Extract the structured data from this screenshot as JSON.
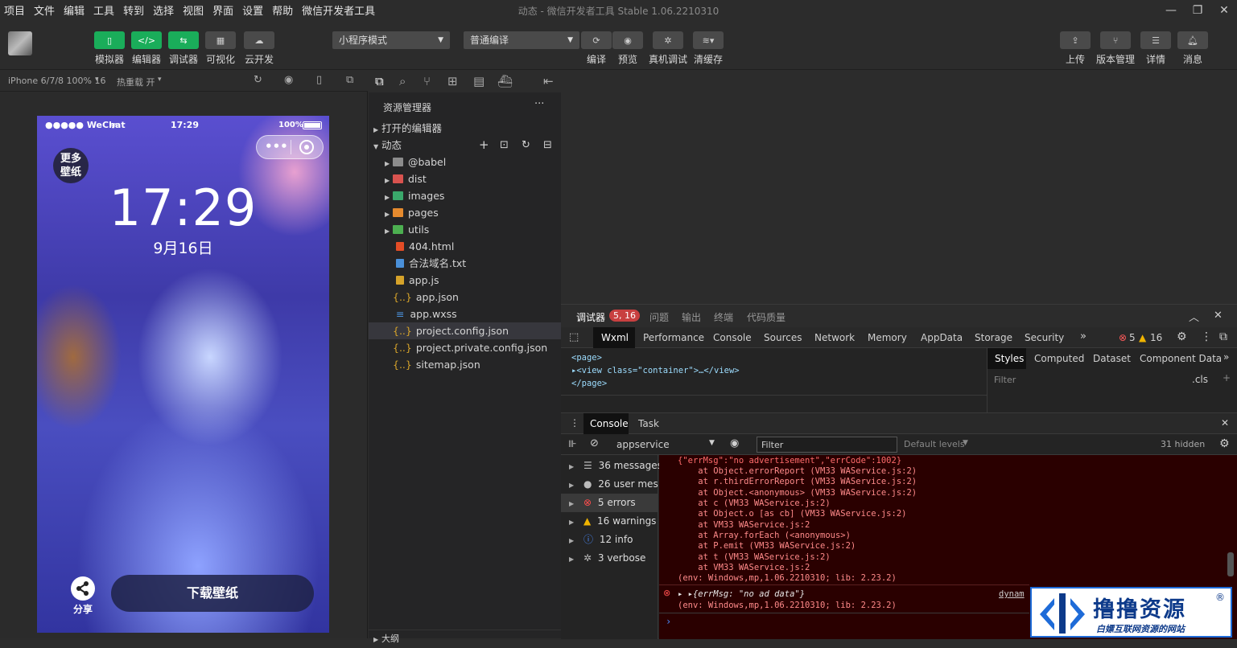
{
  "menubar": {
    "items": [
      "项目",
      "文件",
      "编辑",
      "工具",
      "转到",
      "选择",
      "视图",
      "界面",
      "设置",
      "帮助",
      "微信开发者工具"
    ],
    "title": "动态 - 微信开发者工具 Stable 1.06.2210310"
  },
  "toolbar": {
    "simulator": "模拟器",
    "editor": "编辑器",
    "debugger": "调试器",
    "visual": "可视化",
    "cloud": "云开发",
    "mode_select": "小程序模式",
    "compile_select": "普通编译",
    "compile": "编译",
    "preview": "预览",
    "real_debug": "真机调试",
    "clear_cache": "清缓存",
    "upload": "上传",
    "version": "版本管理",
    "details": "详情",
    "messages": "消息"
  },
  "simulator": {
    "device": "iPhone 6/7/8 100% 16",
    "hot_reload": "热重载 开",
    "carrier": "●●●●● WeChat",
    "time": "17:29",
    "battery": "100%",
    "big_time": "17:29",
    "date": "9月16日",
    "more_wallpaper": "更多壁纸",
    "share": "分享",
    "download": "下载壁纸"
  },
  "explorer": {
    "title": "资源管理器",
    "open_editors": "打开的编辑器",
    "project": "动态",
    "items": [
      {
        "name": "@babel",
        "type": "folder"
      },
      {
        "name": "dist",
        "type": "folder"
      },
      {
        "name": "images",
        "type": "folder"
      },
      {
        "name": "pages",
        "type": "folder"
      },
      {
        "name": "utils",
        "type": "folder"
      },
      {
        "name": "404.html",
        "type": "html"
      },
      {
        "name": "合法域名.txt",
        "type": "txt"
      },
      {
        "name": "app.js",
        "type": "js"
      },
      {
        "name": "app.json",
        "type": "json"
      },
      {
        "name": "app.wxss",
        "type": "wxss"
      },
      {
        "name": "project.config.json",
        "type": "json"
      },
      {
        "name": "project.private.config.json",
        "type": "json"
      },
      {
        "name": "sitemap.json",
        "type": "json"
      }
    ],
    "outline": "大纲"
  },
  "devtools": {
    "top_tabs": [
      "调试器",
      "问题",
      "输出",
      "终端",
      "代码质量"
    ],
    "badge": "5, 16",
    "panel_tabs": [
      "Wxml",
      "Performance",
      "Console",
      "Sources",
      "Network",
      "Memory",
      "AppData",
      "Storage",
      "Security"
    ],
    "error_count": "5",
    "warning_count": "16",
    "wxml_lines": [
      "<page>",
      "▸<view class=\"container\">…</view>",
      "</page>"
    ],
    "style_tabs": [
      "Styles",
      "Computed",
      "Dataset",
      "Component Data"
    ],
    "filter_placeholder": "Filter",
    "cls": ".cls",
    "console_tabs": [
      "Console",
      "Task"
    ],
    "context": "appservice",
    "console_filter": "Filter",
    "default_levels": "Default levels",
    "hidden": "31 hidden",
    "sidebar": [
      {
        "label": "36 messages",
        "icon": "list-icon"
      },
      {
        "label": "26 user mes...",
        "icon": "user-icon"
      },
      {
        "label": "5 errors",
        "icon": "error-icon"
      },
      {
        "label": "16 warnings",
        "icon": "warning-icon"
      },
      {
        "label": "12 info",
        "icon": "info-icon"
      },
      {
        "label": "3 verbose",
        "icon": "bug-icon"
      }
    ],
    "error_lines": [
      "{\"errMsg\":\"no advertisement\",\"errCode\":1002}",
      "    at Object.errorReport (VM33 WAService.js:2)",
      "    at r.thirdErrorReport (VM33 WAService.js:2)",
      "    at Object.<anonymous> (VM33 WAService.js:2)",
      "    at c (VM33 WAService.js:2)",
      "    at Object.o [as cb] (VM33 WAService.js:2)",
      "    at VM33 WAService.js:2",
      "    at Array.forEach (<anonymous>)",
      "    at P.emit (VM33 WAService.js:2)",
      "    at t (VM33 WAService.js:2)",
      "    at VM33 WAService.js:2",
      "(env: Windows,mp,1.06.2210310; lib: 2.23.2)"
    ],
    "error2_line1": "▸ ▸{errMsg: \"no ad data\"}",
    "error2_line2": "(env: Windows,mp,1.06.2210310; lib: 2.23.2)",
    "error2_src": "dynam",
    "prompt": "›"
  },
  "watermark": {
    "title": "撸撸资源",
    "subtitle": "白嫖互联网资源的网站",
    "mark": "®"
  },
  "colors": {
    "accent_green": "#1aad5a",
    "error_red": "#c84040",
    "console_error_bg": "#2a0000"
  }
}
